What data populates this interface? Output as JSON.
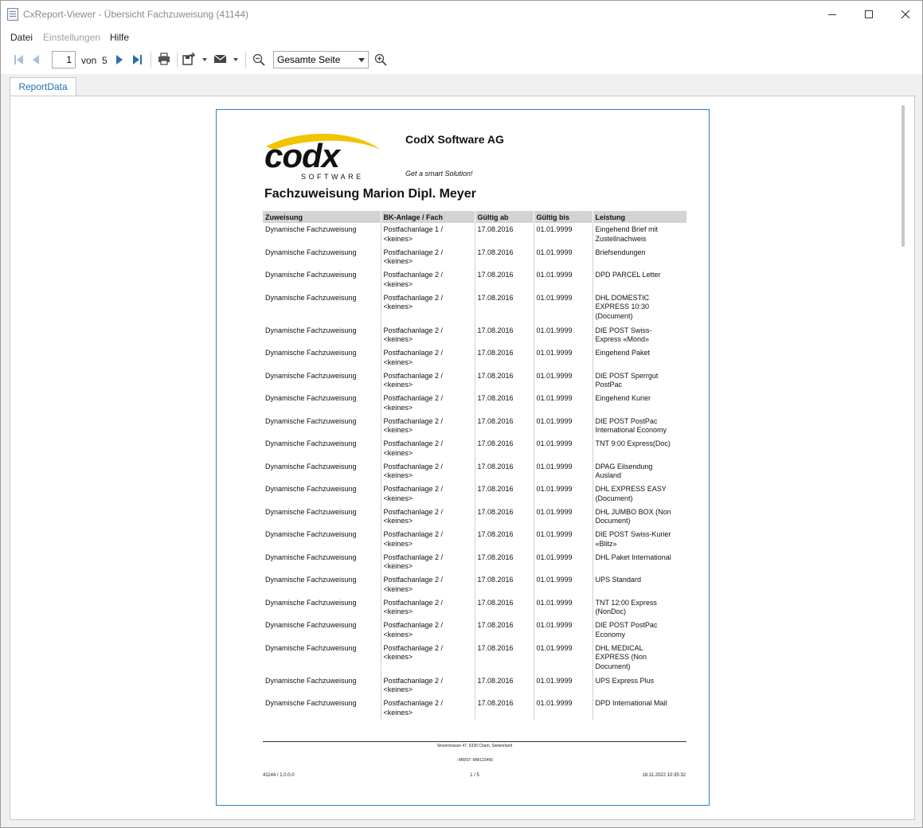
{
  "window": {
    "title": "CxReport-Viewer - Übersicht Fachzuweisung (41144)"
  },
  "menu": {
    "file": "Datei",
    "settings": "Einstellungen",
    "help": "Hilfe"
  },
  "toolbar": {
    "page_current": "1",
    "page_of": "von",
    "page_total": "5",
    "zoom": "Gesamte Seite"
  },
  "tabs": {
    "report_data": "ReportData"
  },
  "report": {
    "company": "CodX Software AG",
    "tagline": "Get a smart Solution!",
    "logo_text": "codx",
    "logo_sub": "SOFTWARE",
    "title": "Fachzuweisung Marion Dipl. Meyer",
    "columns": [
      "Zuweisung",
      "BK-Anlage / Fach",
      "Gültig ab",
      "Gültig bis",
      "Leistung"
    ],
    "rows": [
      [
        "Dynamische Fachzuweisung",
        "Postfachanlage 1 /\n<keines>",
        "17.08.2016",
        "01.01.9999",
        "Eingehend Brief mit\nZustellnachweis"
      ],
      [
        "Dynamische Fachzuweisung",
        "Postfachanlage 2 /\n<keines>",
        "17.08.2016",
        "01.01.9999",
        "Briefsendungen"
      ],
      [
        "Dynamische Fachzuweisung",
        "Postfachanlage 2 /\n<keines>",
        "17.08.2016",
        "01.01.9999",
        "DPD PARCEL Letter"
      ],
      [
        "Dynamische Fachzuweisung",
        "Postfachanlage 2 /\n<keines>",
        "17.08.2016",
        "01.01.9999",
        "DHL DOMESTIC\nEXPRESS 10:30\n(Document)"
      ],
      [
        "Dynamische Fachzuweisung",
        "Postfachanlage 2 /\n<keines>",
        "17.08.2016",
        "01.01.9999",
        "DIE POST Swiss-\nExpress «Mond»"
      ],
      [
        "Dynamische Fachzuweisung",
        "Postfachanlage 2 /\n<keines>",
        "17.08.2016",
        "01.01.9999",
        "Eingehend Paket"
      ],
      [
        "Dynamische Fachzuweisung",
        "Postfachanlage 2 /\n<keines>",
        "17.08.2016",
        "01.01.9999",
        "DIE POST Sperrgut\nPostPac"
      ],
      [
        "Dynamische Fachzuweisung",
        "Postfachanlage 2 /\n<keines>",
        "17.08.2016",
        "01.01.9999",
        "Eingehend Kurier"
      ],
      [
        "Dynamische Fachzuweisung",
        "Postfachanlage 2 /\n<keines>",
        "17.08.2016",
        "01.01.9999",
        "DIE POST PostPac\nInternational Economy"
      ],
      [
        "Dynamische Fachzuweisung",
        "Postfachanlage 2 /\n<keines>",
        "17.08.2016",
        "01.01.9999",
        "TNT 9:00 Express(Doc)"
      ],
      [
        "Dynamische Fachzuweisung",
        "Postfachanlage 2 /\n<keines>",
        "17.08.2016",
        "01.01.9999",
        "DPAG Eilsendung\nAusland"
      ],
      [
        "Dynamische Fachzuweisung",
        "Postfachanlage 2 /\n<keines>",
        "17.08.2016",
        "01.01.9999",
        "DHL EXPRESS EASY\n(Document)"
      ],
      [
        "Dynamische Fachzuweisung",
        "Postfachanlage 2 /\n<keines>",
        "17.08.2016",
        "01.01.9999",
        "DHL JUMBO BOX (Non\nDocument)"
      ],
      [
        "Dynamische Fachzuweisung",
        "Postfachanlage 2 /\n<keines>",
        "17.08.2016",
        "01.01.9999",
        "DIE POST Swiss-Kurier\n«Blitz»"
      ],
      [
        "Dynamische Fachzuweisung",
        "Postfachanlage 2 /\n<keines>",
        "17.08.2016",
        "01.01.9999",
        "DHL Paket International"
      ],
      [
        "Dynamische Fachzuweisung",
        "Postfachanlage 2 /\n<keines>",
        "17.08.2016",
        "01.01.9999",
        "UPS Standard"
      ],
      [
        "Dynamische Fachzuweisung",
        "Postfachanlage 2 /\n<keines>",
        "17.08.2016",
        "01.01.9999",
        "TNT 12:00 Express\n(NonDoc)"
      ],
      [
        "Dynamische Fachzuweisung",
        "Postfachanlage 2 /\n<keines>",
        "17.08.2016",
        "01.01.9999",
        "DIE POST PostPac\nEconomy"
      ],
      [
        "Dynamische Fachzuweisung",
        "Postfachanlage 2 /\n<keines>",
        "17.08.2016",
        "01.01.9999",
        "DHL MEDICAL\nEXPRESS (Non\nDocument)"
      ],
      [
        "Dynamische Fachzuweisung",
        "Postfachanlage 2 /\n<keines>",
        "17.08.2016",
        "01.01.9999",
        "UPS Express Plus"
      ],
      [
        "Dynamische Fachzuweisung",
        "Postfachanlage 2 /\n<keines>",
        "17.08.2016",
        "01.01.9999",
        "DPD International Mail"
      ]
    ],
    "footer": {
      "address": "Sinserstrasse 47, 6330 Cham, Switzerland",
      "vat": "- MWST: MW123456",
      "left": "41144 / 1.0.0.0",
      "page": "1 / 5",
      "timestamp": "18.11.2022 10:35:32"
    }
  },
  "colors": {
    "accent": "#2d7cc4",
    "tab_text": "#1f6fb5",
    "logo_yellow": "#f2c400",
    "header_bg": "#d3d3d3"
  }
}
